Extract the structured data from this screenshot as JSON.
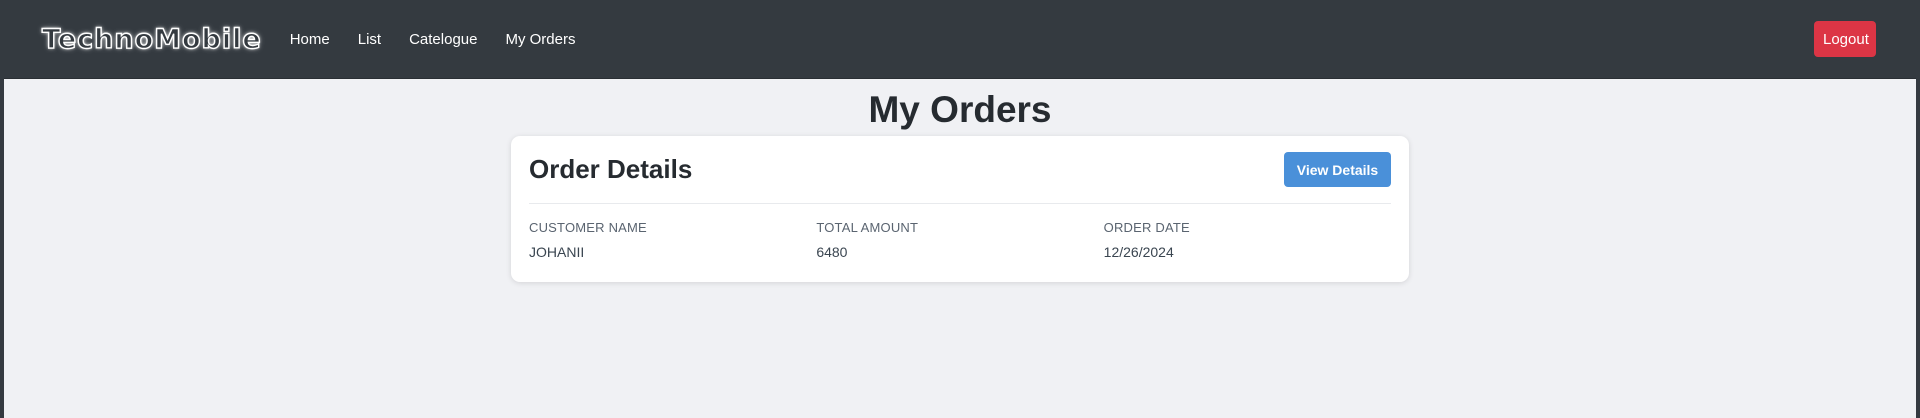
{
  "navbar": {
    "brand": "TechnoMobile",
    "links": [
      "Home",
      "List",
      "Catelogue",
      "My Orders"
    ],
    "logout_label": "Logout"
  },
  "page": {
    "title": "My Orders"
  },
  "order_card": {
    "title": "Order Details",
    "view_details_label": "View Details",
    "fields": [
      {
        "label": "CUSTOMER NAME",
        "value": "JOHANII"
      },
      {
        "label": "TOTAL AMOUNT",
        "value": "6480"
      },
      {
        "label": "ORDER DATE",
        "value": "12/26/2024"
      }
    ]
  },
  "colors": {
    "navbar_bg": "#343a40",
    "logout_bg": "#dc3545",
    "view_details_bg": "#4a90d9",
    "page_bg": "#f0f1f4"
  }
}
